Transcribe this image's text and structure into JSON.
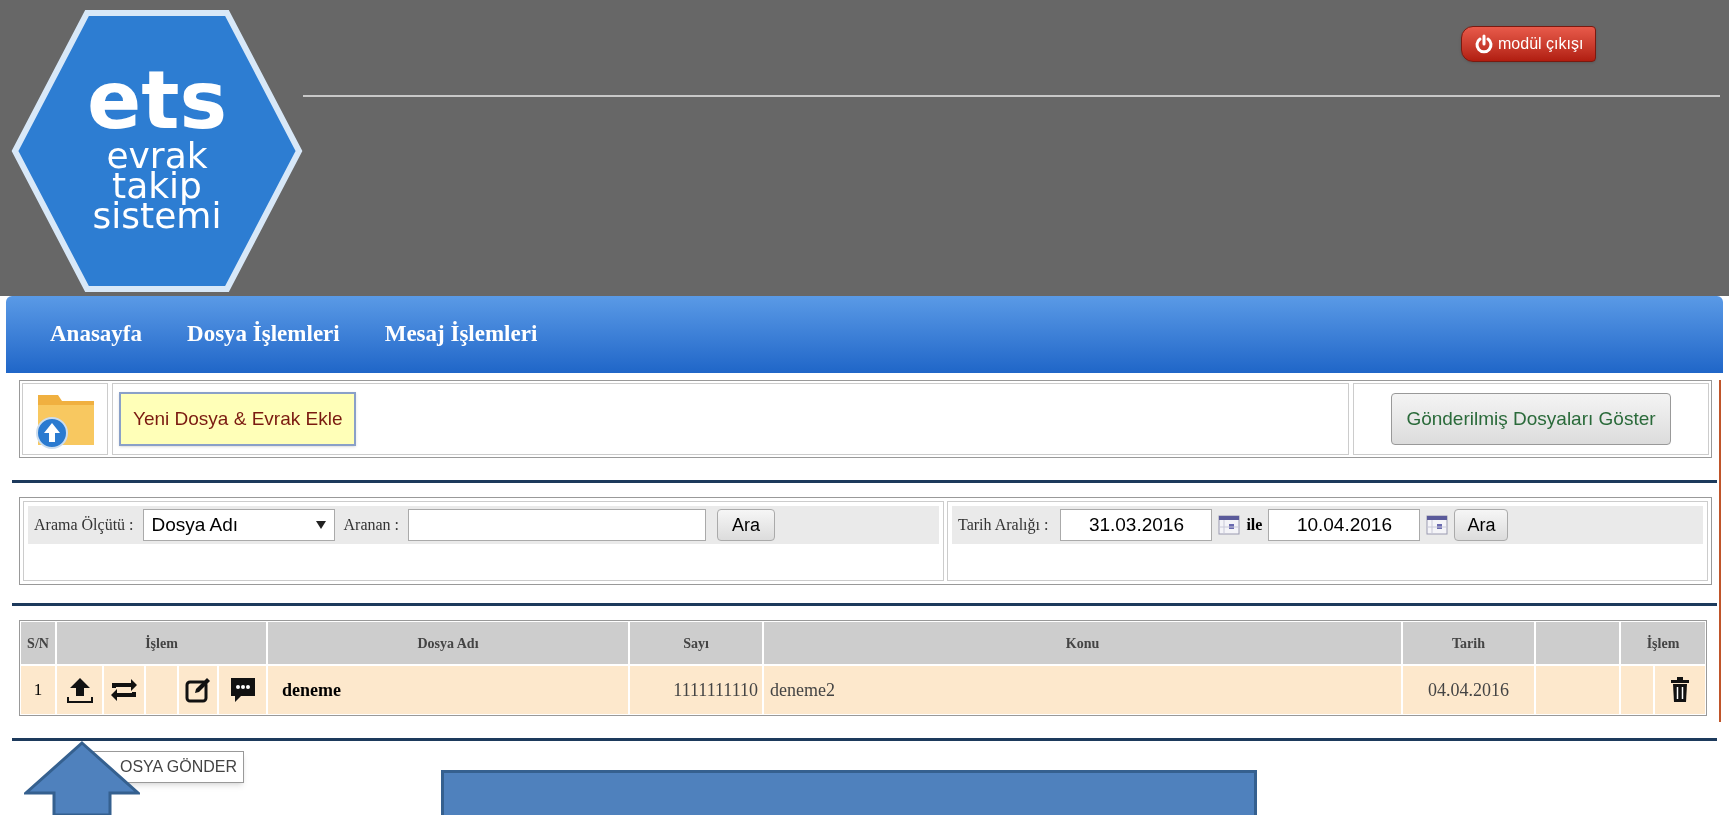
{
  "logo": {
    "title": "ets",
    "subtitle": [
      "evrak",
      "takip",
      "sistemi"
    ]
  },
  "exit_button": {
    "label": "modül çıkışı"
  },
  "nav": [
    {
      "label": "Anasayfa"
    },
    {
      "label": "Dosya İşlemleri"
    },
    {
      "label": "Mesaj İşlemleri"
    }
  ],
  "toolbar": {
    "add_button": "Yeni Dosya & Evrak Ekle",
    "show_sent_button": "Gönderilmiş Dosyaları Göster"
  },
  "search": {
    "criteria_label": "Arama Ölçütü :",
    "criteria_value": "Dosya Adı",
    "query_label": "Aranan :",
    "search_button": "Ara"
  },
  "date_search": {
    "label": "Tarih Aralığı :",
    "from": "31.03.2016",
    "separator": "ile",
    "to": "10.04.2016",
    "search_button": "Ara"
  },
  "table": {
    "columns": [
      "S/N",
      "İşlem",
      "Dosya Adı",
      "Sayı",
      "Konu",
      "Tarih",
      "İşlem"
    ],
    "rows": [
      {
        "sn": "1",
        "file_name": "deneme",
        "number": "1111111110",
        "subject": "deneme2",
        "date": "04.04.2016"
      }
    ]
  },
  "tooltip": "OSYA GÖNDER"
}
